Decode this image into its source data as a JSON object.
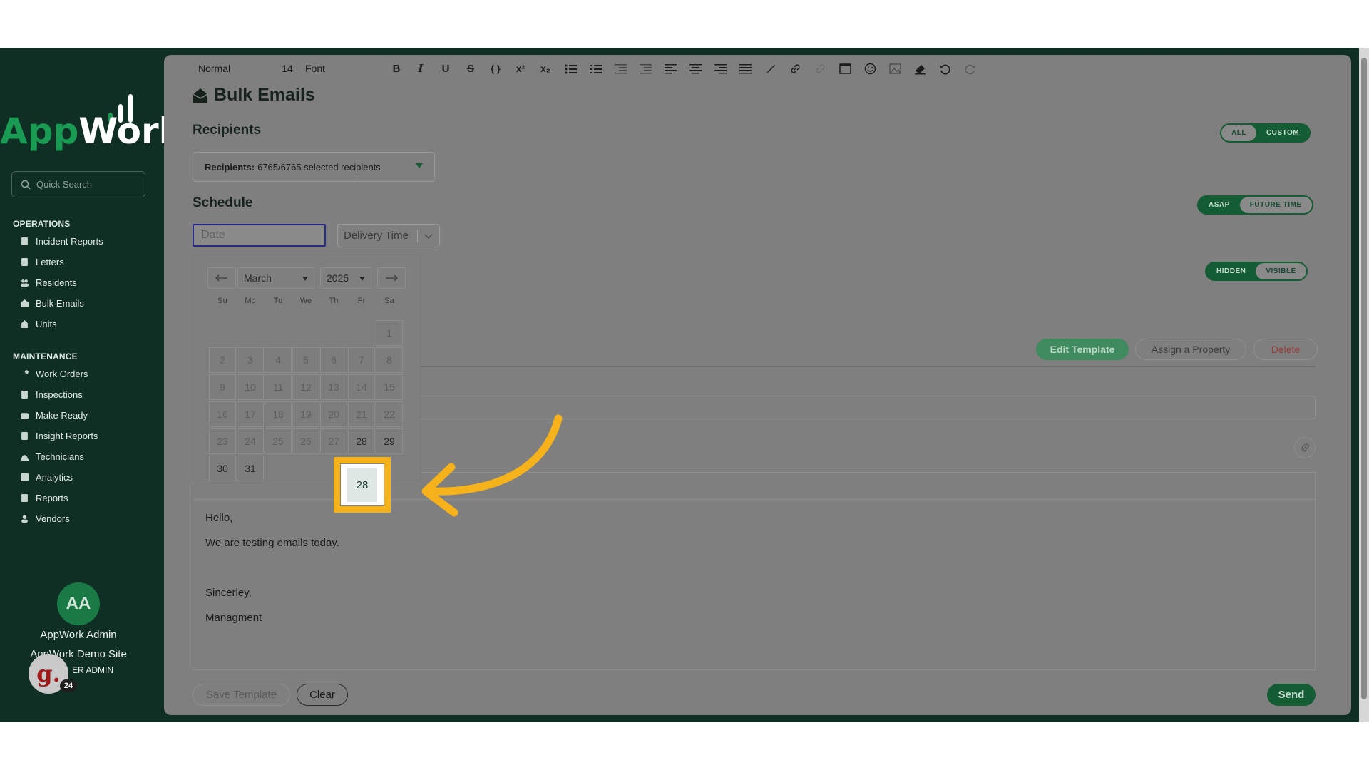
{
  "sidebar": {
    "logo_text_app": "App",
    "logo_text_work": "Work",
    "search_placeholder": "Quick Search",
    "sections": [
      {
        "title": "OPERATIONS",
        "items": [
          "Incident Reports",
          "Letters",
          "Residents",
          "Bulk Emails",
          "Units"
        ]
      },
      {
        "title": "MAINTENANCE",
        "items": [
          "Work Orders",
          "Inspections",
          "Make Ready",
          "Insight Reports",
          "Technicians",
          "Analytics",
          "Reports",
          "Vendors"
        ]
      }
    ],
    "profile": {
      "initials": "AA",
      "name": "AppWork Admin",
      "site": "AppWork Demo Site",
      "role": "ER ADMIN"
    },
    "badge": {
      "letter": "g.",
      "count": "24"
    }
  },
  "main": {
    "title": "Bulk Emails",
    "recipients_title": "Recipients",
    "recipients_label": "Recipients:",
    "recipients_value": "6765/6765 selected recipients",
    "recipients_toggle": {
      "all": "ALL",
      "custom": "CUSTOM"
    },
    "schedule_title": "Schedule",
    "schedule_toggle": {
      "asap": "ASAP",
      "future": "FUTURE TIME"
    },
    "visibility_toggle": {
      "hidden": "HIDDEN",
      "visible": "VISIBLE"
    },
    "date_placeholder": "Date",
    "delivery_time": "Delivery Time",
    "buttons": {
      "edit_template": "Edit Template",
      "assign_property": "Assign a Property",
      "delete": "Delete",
      "save_template": "Save Template",
      "clear": "Clear",
      "send": "Send"
    },
    "toolbar": {
      "format": "Normal",
      "size": "14",
      "font": "Font"
    },
    "editor_lines": [
      "Hello,",
      "We are testing emails today.",
      "",
      "Sincerley,",
      "Managment"
    ]
  },
  "datepicker": {
    "month": "March",
    "year": "2025",
    "weekdays": [
      "Su",
      "Mo",
      "Tu",
      "We",
      "Th",
      "Fr",
      "Sa"
    ],
    "selected_day": "28"
  },
  "colors": {
    "brand_green": "#145c34",
    "logo_green": "#1a9b54",
    "highlight": "#f6b21a"
  }
}
